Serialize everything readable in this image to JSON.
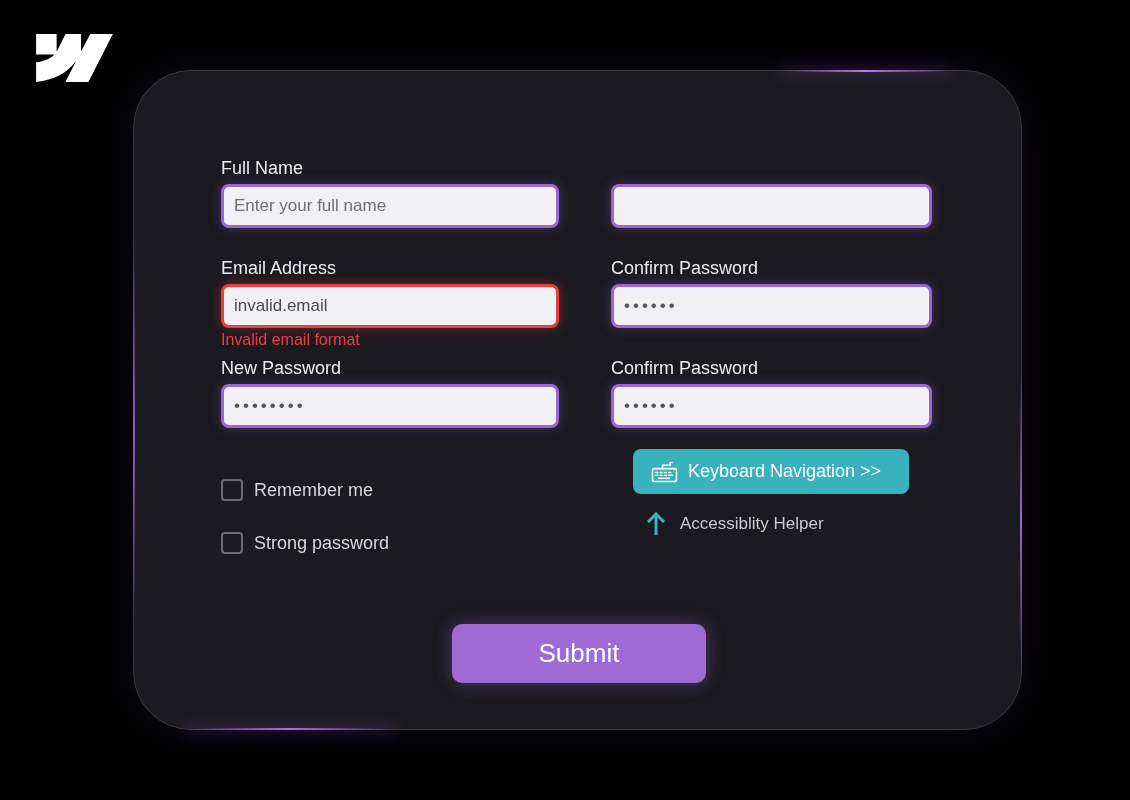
{
  "left_column": {
    "fields": [
      {
        "label": "Full Name",
        "placeholder": "Enter your full name",
        "invalid": false
      },
      {
        "label": "Email Address",
        "value": "invalid.email",
        "invalid": true,
        "error": "Invalid email format"
      },
      {
        "label": "New Password",
        "value": "••••••••",
        "invalid": false
      }
    ],
    "checkboxes": [
      {
        "label": "Remember me",
        "checked": false
      },
      {
        "label": "Strong password",
        "checked": false
      }
    ]
  },
  "right_column": {
    "fields": [
      {
        "invalid": false
      },
      {
        "label": "Confirm Password",
        "value": "••••••",
        "invalid": false
      },
      {
        "label": "Confirm Password",
        "value": "••••••",
        "invalid": false
      }
    ],
    "keyboard_button": {
      "label": "Keyboard Navigation >>"
    },
    "helper_link": {
      "label": "Accessiblity Helper"
    }
  },
  "submit_button": {
    "label": "Submit"
  }
}
